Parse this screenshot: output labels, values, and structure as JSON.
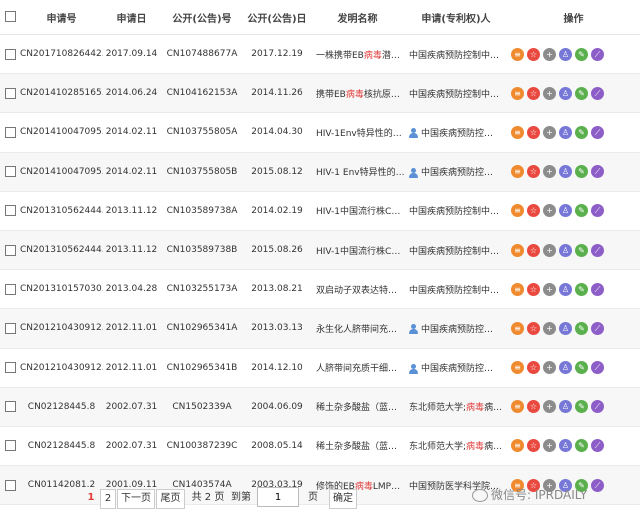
{
  "header": {
    "select_all": "",
    "app_no": "申请号",
    "app_date": "申请日",
    "pub_no": "公开(公告)号",
    "pub_date": "公开(公告)日",
    "title": "发明名称",
    "applicant": "申请(专利权)人",
    "ops": "操作"
  },
  "rows": [
    {
      "app_no": "CN201710826442.5",
      "app_date": "2017.09.14",
      "pub_no": "CN107488677A",
      "pub_date": "2017.12.19",
      "title_pre": "一株携带EB",
      "title_hl": "病毒",
      "title_post": "潜伏膜…",
      "applicant_pre": "中国疾病预防控制中…",
      "applicant_hl": "",
      "applicant_post": "",
      "person": false
    },
    {
      "app_no": "CN201410285165.8",
      "app_date": "2014.06.24",
      "pub_no": "CN104162153A",
      "pub_date": "2014.11.26",
      "title_pre": "携带EB",
      "title_hl": "病毒",
      "title_post": "核抗原1的…",
      "applicant_pre": "中国疾病预防控制中…",
      "applicant_hl": "",
      "applicant_post": "",
      "person": false
    },
    {
      "app_no": "CN201410047095.2",
      "app_date": "2014.02.11",
      "pub_no": "CN103755805A",
      "pub_date": "2014.04.30",
      "title_pre": "HIV-1Env特异性的全…",
      "title_hl": "",
      "title_post": "",
      "applicant_pre": "中国疾病预防控…",
      "applicant_hl": "",
      "applicant_post": "",
      "person": true
    },
    {
      "app_no": "CN201410047095.2",
      "app_date": "2014.02.11",
      "pub_no": "CN103755805B",
      "pub_date": "2015.08.12",
      "title_pre": "HIV-1 Env特异性的全…",
      "title_hl": "",
      "title_post": "",
      "applicant_pre": "中国疾病预防控…",
      "applicant_hl": "",
      "applicant_post": "",
      "person": true
    },
    {
      "app_no": "CN201310562444.X",
      "app_date": "2013.11.12",
      "pub_no": "CN103589738A",
      "pub_date": "2014.02.19",
      "title_pre": "HIV-1中国流行株CRF0…",
      "title_hl": "",
      "title_post": "",
      "applicant_pre": "中国疾病预防控制中…",
      "applicant_hl": "",
      "applicant_post": "",
      "person": false
    },
    {
      "app_no": "CN201310562444.X",
      "app_date": "2013.11.12",
      "pub_no": "CN103589738B",
      "pub_date": "2015.08.26",
      "title_pre": "HIV-1中国流行株CRF0…",
      "title_hl": "",
      "title_post": "",
      "applicant_pre": "中国疾病预防控制中…",
      "applicant_hl": "",
      "applicant_post": "",
      "person": false
    },
    {
      "app_no": "CN201310157030.9",
      "app_date": "2013.04.28",
      "pub_no": "CN103255173A",
      "pub_date": "2013.08.21",
      "title_pre": "双启动子双表达特异性…",
      "title_hl": "",
      "title_post": "",
      "applicant_pre": "中国疾病预防控制中…",
      "applicant_hl": "",
      "applicant_post": "",
      "person": false
    },
    {
      "app_no": "CN201210430912.3",
      "app_date": "2012.11.01",
      "pub_no": "CN102965341A",
      "pub_date": "2013.03.13",
      "title_pre": "永生化人脐带间充质干…",
      "title_hl": "",
      "title_post": "",
      "applicant_pre": "中国疾病预防控…",
      "applicant_hl": "",
      "applicant_post": "",
      "person": true
    },
    {
      "app_no": "CN201210430912.3",
      "app_date": "2012.11.01",
      "pub_no": "CN102965341B",
      "pub_date": "2014.12.10",
      "title_pre": "人脐带间充质干细胞系…",
      "title_hl": "",
      "title_post": "",
      "applicant_pre": "中国疾病预防控…",
      "applicant_hl": "",
      "applicant_post": "",
      "person": true
    },
    {
      "app_no": "CN02128445.8",
      "app_date": "2002.07.31",
      "pub_no": "CN1502339A",
      "pub_date": "2004.06.09",
      "title_pre": "稀土杂多酸盐（蓝）类…",
      "title_hl": "",
      "title_post": "",
      "applicant_pre": "东北师范大学;",
      "applicant_hl": "病毒",
      "applicant_post": "病…",
      "person": false
    },
    {
      "app_no": "CN02128445.8",
      "app_date": "2002.07.31",
      "pub_no": "CN100387239C",
      "pub_date": "2008.05.14",
      "title_pre": "稀土杂多酸盐（蓝）类…",
      "title_hl": "",
      "title_post": "",
      "applicant_pre": "东北师范大学;",
      "applicant_hl": "病毒",
      "applicant_post": "病…",
      "person": false
    },
    {
      "app_no": "CN01142081.2",
      "app_date": "2001.09.11",
      "pub_no": "CN1403574A",
      "pub_date": "2003.03.19",
      "title_pre": "修饰的EB",
      "title_hl": "病毒",
      "title_post": "LMP1编…",
      "applicant_pre": "中国预防医学科学院…",
      "applicant_hl": "",
      "applicant_post": "",
      "person": false
    }
  ],
  "op_icons": [
    {
      "icon": "list-icon",
      "glyph": "≡",
      "color": "#ef8a2e"
    },
    {
      "icon": "star-icon",
      "glyph": "☆",
      "color": "#e9493f"
    },
    {
      "icon": "plus-icon",
      "glyph": "+",
      "color": "#8c8c8c"
    },
    {
      "icon": "user-icon",
      "glyph": "♙",
      "color": "#7677d6"
    },
    {
      "icon": "edit-icon",
      "glyph": "✎",
      "color": "#5ab04d"
    },
    {
      "icon": "trend-icon",
      "glyph": "⟋",
      "color": "#8d5ec7"
    }
  ],
  "pager": {
    "page1": "1",
    "page2": "2",
    "next": "下一页",
    "last": "尾页",
    "total": "共 2 页",
    "goto": "到第",
    "input_value": "1",
    "page_unit": "页",
    "confirm": "确定"
  },
  "watermark": "微信号: IPRDAILY"
}
